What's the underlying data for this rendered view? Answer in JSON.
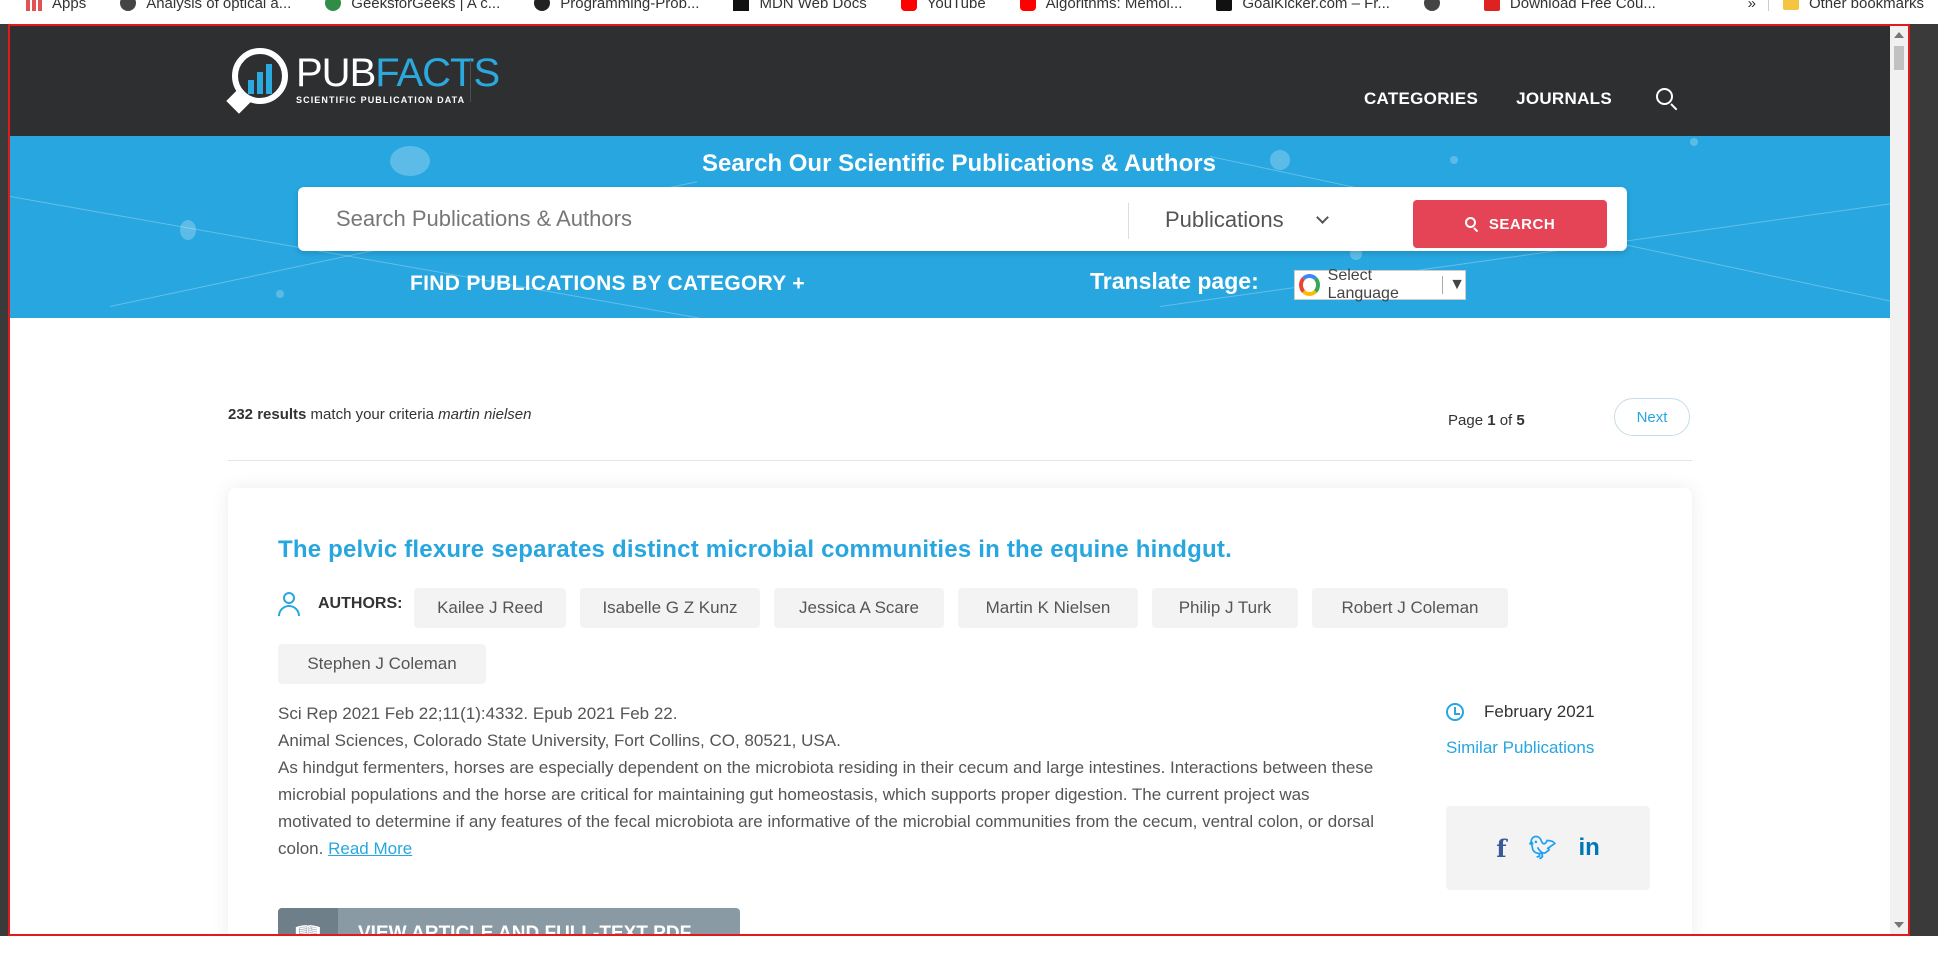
{
  "bookmarks": {
    "items": [
      {
        "label": "Apps",
        "icon": "apps-icon"
      },
      {
        "label": "Analysis of optical a...",
        "icon": "globe-icon"
      },
      {
        "label": "GeeksforGeeks | A c...",
        "icon": "gfg-icon"
      },
      {
        "label": "Programming-Prob...",
        "icon": "github-icon"
      },
      {
        "label": "MDN Web Docs",
        "icon": "mdn-icon"
      },
      {
        "label": "YouTube",
        "icon": "youtube-icon"
      },
      {
        "label": "Algorithms: Memoi...",
        "icon": "youtube-icon"
      },
      {
        "label": "GoalKicker.com – Fr...",
        "icon": "goalkicker-icon"
      },
      {
        "label": "",
        "icon": "globe-icon"
      },
      {
        "label": "Download Free Cou...",
        "icon": "fco-icon"
      }
    ],
    "overflow": "»",
    "other": "Other bookmarks"
  },
  "header": {
    "logo_name_a": "PUB",
    "logo_name_b": "FACTS",
    "logo_tagline": "SCIENTIFIC PUBLICATION DATA",
    "nav": [
      "CATEGORIES",
      "JOURNALS"
    ]
  },
  "hero": {
    "title": "Search Our Scientific Publications & Authors",
    "search_placeholder": "Search Publications & Authors",
    "search_type": "Publications",
    "search_button": "SEARCH",
    "find_category": "FIND PUBLICATIONS BY CATEGORY +",
    "translate_label": "Translate page:",
    "language_select": "Select Language"
  },
  "results": {
    "count": "232 results",
    "text": " match your criteria ",
    "query": "martin nielsen",
    "page_prefix": "Page ",
    "page_current": "1",
    "page_of": " of ",
    "page_total": "5",
    "next": "Next"
  },
  "article": {
    "title": "The pelvic flexure separates distinct microbial communities in the equine hindgut.",
    "authors_label": "AUTHORS:",
    "authors": [
      "Kailee J Reed",
      "Isabelle G Z Kunz",
      "Jessica A Scare",
      "Martin K Nielsen",
      "Philip J Turk",
      "Robert J Coleman",
      "Stephen J Coleman"
    ],
    "citation": "Sci Rep 2021 Feb 22;11(1):4332. Epub 2021 Feb 22.",
    "affiliation": "Animal Sciences, Colorado State University, Fort Collins, CO, 80521, USA.",
    "abstract": "As hindgut fermenters, horses are especially dependent on the microbiota residing in their cecum and large intestines. Interactions between these microbial populations and the horse are critical for maintaining gut homeostasis, which supports proper digestion. The current project was motivated to determine if any features of the fecal microbiota are informative of the microbial communities from the cecum, ventral colon, or dorsal colon. ",
    "read_more": "Read More",
    "date": "February 2021",
    "similar": "Similar Publications",
    "share": {
      "facebook": "f",
      "linkedin": "in"
    },
    "view_button": "VIEW ARTICLE AND FULL-TEXT PDF"
  },
  "colors": {
    "accent": "#27a6df",
    "header_bg": "#2e2f31",
    "search_button": "#e44455"
  }
}
